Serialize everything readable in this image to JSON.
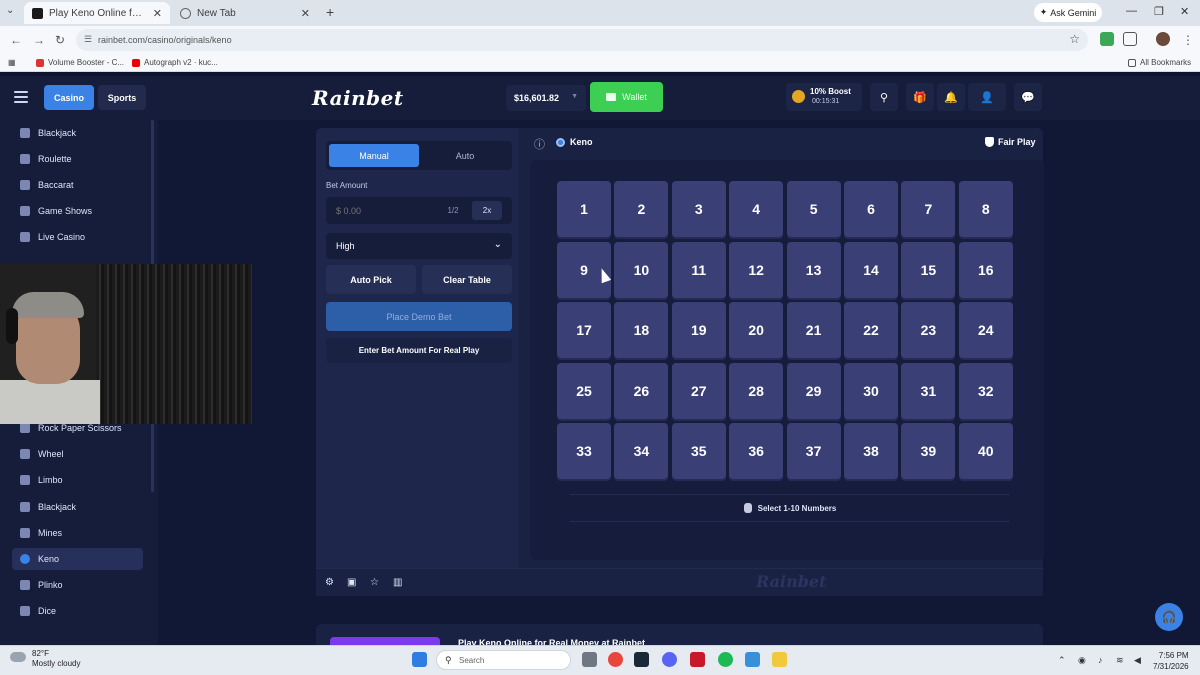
{
  "browser": {
    "tabs": [
      {
        "title": "Play Keno Online for Real Money",
        "active": true
      },
      {
        "title": "New Tab",
        "active": false
      }
    ],
    "ask_gemini": "Ask Gemini",
    "url": "rainbet.com/casino/originals/keno",
    "bookmarks": [
      "Volume Booster - C...",
      "Autograph v2 · kuc...",
      "All Bookmarks"
    ]
  },
  "header": {
    "nav_tabs": [
      "Casino",
      "Sports"
    ],
    "logo": "Rainbet",
    "balance": "$16,601.82",
    "wallet_label": "Wallet",
    "boost_title": "10% Boost",
    "boost_timer": "00:15:31",
    "accent": "#3b82e6",
    "wallet_color": "#3dcf54"
  },
  "sidebar": {
    "items": [
      {
        "label": "Blackjack",
        "icon": "cards-icon",
        "active": false
      },
      {
        "label": "Roulette",
        "icon": "roulette-icon",
        "active": false
      },
      {
        "label": "Baccarat",
        "icon": "baccarat-icon",
        "active": false
      },
      {
        "label": "Game Shows",
        "icon": "microphone-icon",
        "active": false
      },
      {
        "label": "Live Casino",
        "icon": "live-icon",
        "active": false
      },
      {
        "label": "Rock Paper Scissors",
        "icon": "hand-icon",
        "active": false
      },
      {
        "label": "Wheel",
        "icon": "wheel-icon",
        "active": false
      },
      {
        "label": "Limbo",
        "icon": "limbo-icon",
        "active": false
      },
      {
        "label": "Blackjack",
        "icon": "cards-icon",
        "active": false
      },
      {
        "label": "Mines",
        "icon": "mine-icon",
        "active": false
      },
      {
        "label": "Keno",
        "icon": "keno-icon",
        "active": true
      },
      {
        "label": "Plinko",
        "icon": "plinko-icon",
        "active": false
      },
      {
        "label": "Dice",
        "icon": "dice-icon",
        "active": false
      }
    ]
  },
  "controls": {
    "mode_manual": "Manual",
    "mode_auto": "Auto",
    "bet_amount_label": "Bet Amount",
    "bet_placeholder": "$ 0.00",
    "half_label": "1/2",
    "double_label": "2x",
    "risk_value": "High",
    "auto_pick": "Auto Pick",
    "clear_table": "Clear Table",
    "place_bet": "Place Demo Bet",
    "real_play": "Enter Bet Amount For Real Play"
  },
  "game": {
    "title": "Keno",
    "fair_play": "Fair Play",
    "numbers": [
      1,
      2,
      3,
      4,
      5,
      6,
      7,
      8,
      9,
      10,
      11,
      12,
      13,
      14,
      15,
      16,
      17,
      18,
      19,
      20,
      21,
      22,
      23,
      24,
      25,
      26,
      27,
      28,
      29,
      30,
      31,
      32,
      33,
      34,
      35,
      36,
      37,
      38,
      39,
      40
    ],
    "hint": "Select 1-10 Numbers",
    "watermark": "Rainbet"
  },
  "promo": {
    "title": "Play Keno Online for Real Money at Rainbet"
  },
  "taskbar": {
    "temperature": "82°F",
    "weather": "Mostly cloudy",
    "search_placeholder": "Search",
    "time": "7:56 PM",
    "date": "7/31/2026"
  }
}
